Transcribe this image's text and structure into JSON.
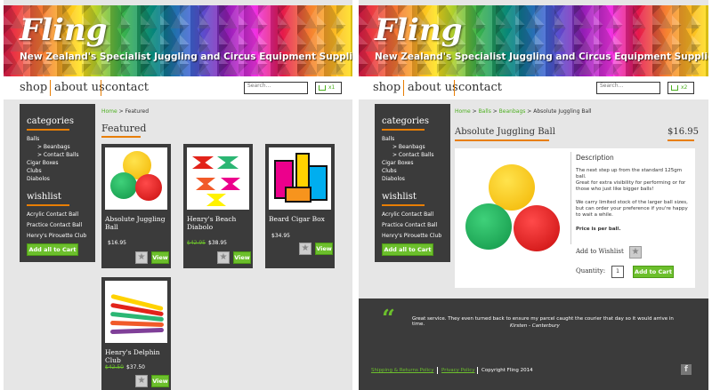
{
  "site": {
    "logo": "Fling",
    "tagline": "New Zealand's Specialist Juggling and Circus Equipment Suppliers",
    "nav": [
      "shop",
      "about us",
      "contact"
    ],
    "search_placeholder": "Search..."
  },
  "left": {
    "cart_count": "x1",
    "breadcrumb": {
      "home": "Home",
      "sep": " > ",
      "current": "Featured"
    },
    "section_title": "Featured",
    "categories_title": "categories",
    "categories": [
      {
        "label": "Balls",
        "sub": false
      },
      {
        "label": "> Beanbags",
        "sub": true
      },
      {
        "label": "> Contact Balls",
        "sub": true
      },
      {
        "label": "Cigar Boxes",
        "sub": false
      },
      {
        "label": "Clubs",
        "sub": false
      },
      {
        "label": "Diabolos",
        "sub": false
      }
    ],
    "wishlist_title": "wishlist",
    "wishlist": [
      "Acrylic Contact Ball",
      "Practice Contact Ball",
      "Henry's Pirouette Club"
    ],
    "add_all_label": "Add all to Cart",
    "products": [
      {
        "name": "Absolute Juggling Ball",
        "old_price": "",
        "price": "$16.95",
        "view": "View"
      },
      {
        "name": "Henry's Beach Diabolo",
        "old_price": "$42.95",
        "price": "$38.95",
        "view": "View"
      },
      {
        "name": "Beard Cigar Box",
        "old_price": "",
        "price": "$34.95",
        "view": "View"
      },
      {
        "name": "Henry's Delphin Club",
        "old_price": "$42.50",
        "price": "$37.50",
        "view": "View"
      }
    ]
  },
  "right": {
    "cart_count": "x2",
    "breadcrumb": {
      "home": "Home",
      "balls": "Balls",
      "beanbags": "Beanbags",
      "current": "Absolute Juggling Ball",
      "sep": " > "
    },
    "product_title": "Absolute Juggling Ball",
    "price": "$16.95",
    "description_title": "Description",
    "description": [
      "The next step up from the standard 125gm ball.",
      "Great for extra visibility for performing or for those who just like bigger balls!",
      "We carry limited stock of the larger ball sizes, but can order your preference if you're happy to wait a while.",
      "Price is per ball."
    ],
    "add_to_wishlist": "Add to Wishlist",
    "quantity_label": "Quantity:",
    "quantity_value": "1",
    "add_to_cart": "Add to Cart",
    "testimonial": "Great service. They even turned back to ensure my parcel caught the courier that day so it would arrive in time.",
    "testimonial_author": "Kirsten - Canterbury",
    "footer_links": [
      "Shipping & Returns Policy",
      "Privacy Policy"
    ],
    "copyright": "Copyright Fling 2014"
  },
  "colors": {
    "accent": "#e87e04",
    "green": "#6cbf2c",
    "dark": "#3b3b3b"
  }
}
